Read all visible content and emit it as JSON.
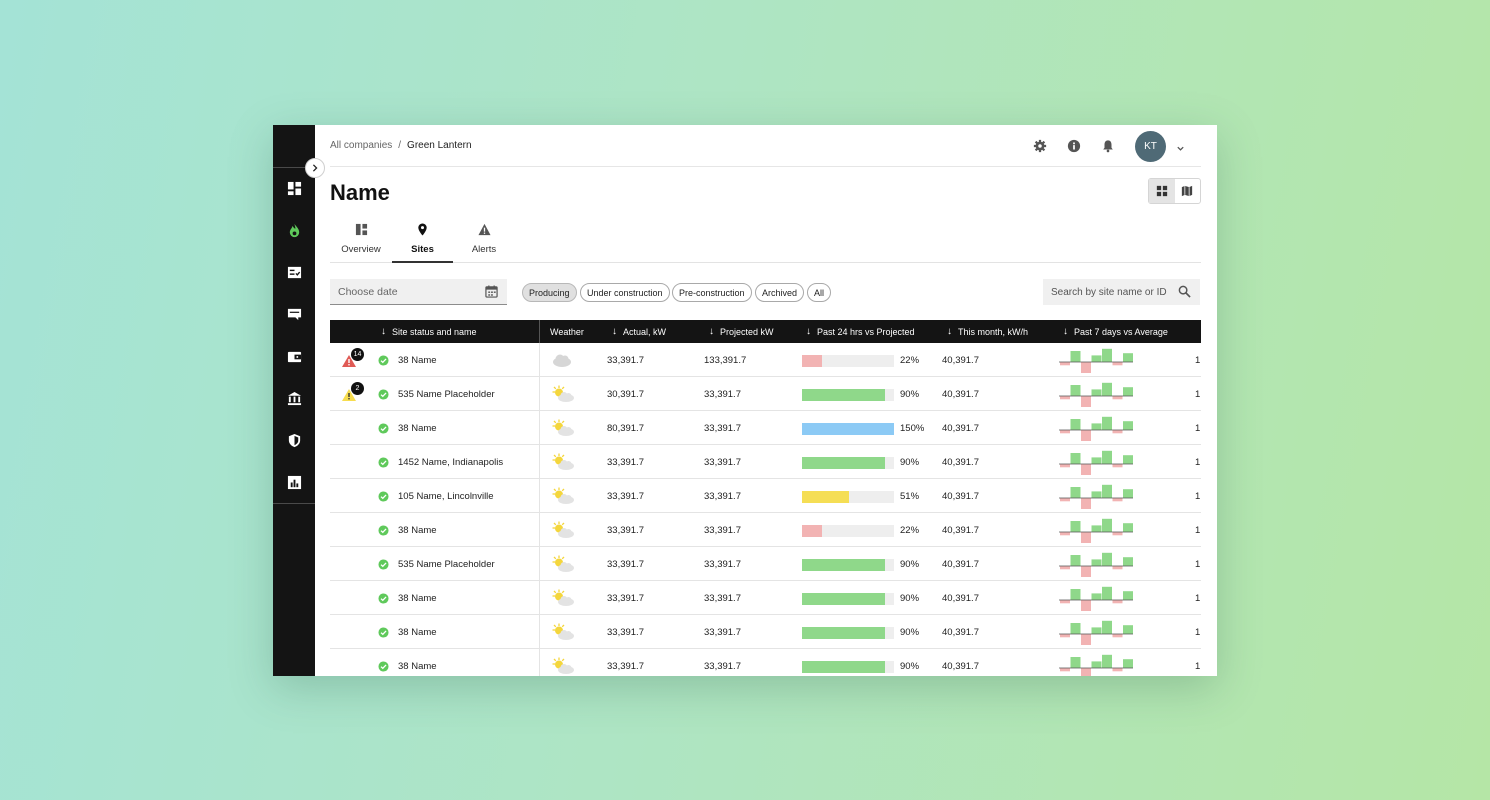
{
  "breadcrumb": {
    "parent": "All companies",
    "separator": "/",
    "current": "Green Lantern"
  },
  "header": {
    "avatar_initials": "KT"
  },
  "page": {
    "title": "Name"
  },
  "tabs": [
    {
      "label": "Overview",
      "icon": "dashboard-icon",
      "active": false
    },
    {
      "label": "Sites",
      "icon": "location-pin-icon",
      "active": true
    },
    {
      "label": "Alerts",
      "icon": "warning-icon",
      "active": false
    }
  ],
  "filters": {
    "date_placeholder": "Choose date",
    "chips": [
      "Producing",
      "Under construction",
      "Pre-construction",
      "Archived",
      "All"
    ],
    "selected_chip": "Producing",
    "search_placeholder": "Search by site name or ID"
  },
  "table": {
    "columns": [
      "Site status and name",
      "Weather",
      "Actual, kW",
      "Projected kW",
      "Past 24 hrs vs Projected",
      "This month, kW/h",
      "Past 7 days vs Average"
    ],
    "rows": [
      {
        "alert": "red",
        "alert_count": "14",
        "name": "38 Name",
        "weather": "cloudy",
        "actual": "33,391.7",
        "projected": "133,391.7",
        "pct_label": "22%",
        "pct": 22,
        "bar_color": "#f2b3b3",
        "month": "40,391.7",
        "trailing": "1"
      },
      {
        "alert": "yellow",
        "alert_count": "2",
        "name": "535 Name Placeholder",
        "weather": "partly-sunny",
        "actual": "30,391.7",
        "projected": "33,391.7",
        "pct_label": "90%",
        "pct": 90,
        "bar_color": "#8fd88a",
        "month": "40,391.7",
        "trailing": "1"
      },
      {
        "alert": "",
        "alert_count": "",
        "name": "38 Name",
        "weather": "partly-sunny",
        "actual": "80,391.7",
        "projected": "33,391.7",
        "pct_label": "150%",
        "pct": 150,
        "bar_color": "#8ccaf5",
        "month": "40,391.7",
        "trailing": "1"
      },
      {
        "alert": "",
        "alert_count": "",
        "name": "1452  Name, Indianapolis",
        "weather": "partly-sunny",
        "actual": "33,391.7",
        "projected": "33,391.7",
        "pct_label": "90%",
        "pct": 90,
        "bar_color": "#8fd88a",
        "month": "40,391.7",
        "trailing": "1"
      },
      {
        "alert": "",
        "alert_count": "",
        "name": "105  Name, Lincolnville",
        "weather": "partly-sunny",
        "actual": "33,391.7",
        "projected": "33,391.7",
        "pct_label": "51%",
        "pct": 51,
        "bar_color": "#f5de55",
        "month": "40,391.7",
        "trailing": "1"
      },
      {
        "alert": "",
        "alert_count": "",
        "name": "38 Name",
        "weather": "partly-sunny",
        "actual": "33,391.7",
        "projected": "33,391.7",
        "pct_label": "22%",
        "pct": 22,
        "bar_color": "#f2b3b3",
        "month": "40,391.7",
        "trailing": "1"
      },
      {
        "alert": "",
        "alert_count": "",
        "name": "535  Name Placeholder",
        "weather": "partly-sunny",
        "actual": "33,391.7",
        "projected": "33,391.7",
        "pct_label": "90%",
        "pct": 90,
        "bar_color": "#8fd88a",
        "month": "40,391.7",
        "trailing": "1"
      },
      {
        "alert": "",
        "alert_count": "",
        "name": "38 Name",
        "weather": "partly-sunny",
        "actual": "33,391.7",
        "projected": "33,391.7",
        "pct_label": "90%",
        "pct": 90,
        "bar_color": "#8fd88a",
        "month": "40,391.7",
        "trailing": "1"
      },
      {
        "alert": "",
        "alert_count": "",
        "name": "38 Name",
        "weather": "partly-sunny",
        "actual": "33,391.7",
        "projected": "33,391.7",
        "pct_label": "90%",
        "pct": 90,
        "bar_color": "#8fd88a",
        "month": "40,391.7",
        "trailing": "1"
      },
      {
        "alert": "",
        "alert_count": "",
        "name": "38 Name",
        "weather": "partly-sunny",
        "actual": "33,391.7",
        "projected": "33,391.7",
        "pct_label": "90%",
        "pct": 90,
        "bar_color": "#8fd88a",
        "month": "40,391.7",
        "trailing": "1"
      }
    ],
    "sparkline_values": [
      -0.3,
      1,
      -1,
      0.6,
      1.2,
      -0.3,
      0.8
    ]
  },
  "colors": {
    "accent_green": "#5fc95b",
    "rail_bg": "#141414",
    "alert_red": "#e05a55",
    "alert_yellow": "#f7dd4f"
  },
  "rail_icons": [
    "dashboard-icon",
    "flame-icon",
    "checklist-icon",
    "chat-icon",
    "wallet-icon",
    "bank-icon",
    "shield-icon",
    "report-icon"
  ]
}
